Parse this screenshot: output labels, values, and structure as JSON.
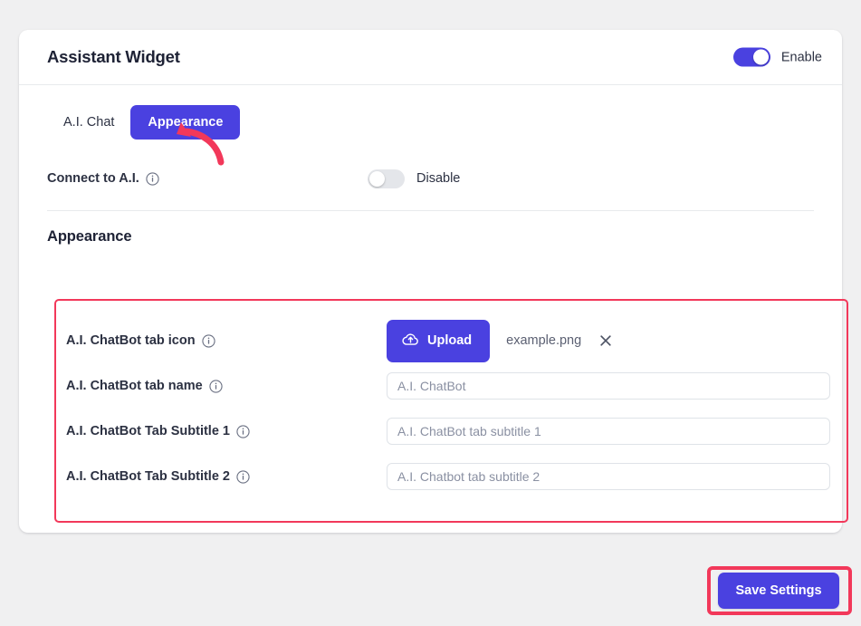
{
  "card": {
    "title": "Assistant Widget",
    "enable_toggle": {
      "label": "Enable",
      "state": "on",
      "icon": "toggle-on-icon"
    }
  },
  "tabs": [
    {
      "label": "A.I. Chat",
      "active": false
    },
    {
      "label": "Appearance",
      "active": true
    }
  ],
  "annotation": {
    "arrow_icon": "curved-arrow-icon",
    "color": "#f2385a"
  },
  "connect": {
    "label": "Connect to A.I.",
    "info_icon": "info-icon",
    "toggle": {
      "label": "Disable",
      "state": "off",
      "icon": "toggle-off-icon"
    }
  },
  "section": {
    "title": "Appearance"
  },
  "form": {
    "rows": [
      {
        "label": "A.I. ChatBot tab icon",
        "info_icon": "info-icon",
        "type": "upload",
        "upload_label": "Upload",
        "upload_icon": "cloud-upload-icon",
        "file_name": "example.png",
        "remove_icon": "close-icon"
      },
      {
        "label": "A.I. ChatBot tab name",
        "info_icon": "info-icon",
        "type": "text",
        "value": "",
        "placeholder": "A.I. ChatBot"
      },
      {
        "label": "A.I. ChatBot Tab Subtitle 1",
        "info_icon": "info-icon",
        "type": "text",
        "value": "",
        "placeholder": "A.I. ChatBot tab subtitle 1"
      },
      {
        "label": "A.I. ChatBot Tab Subtitle 2",
        "info_icon": "info-icon",
        "type": "text",
        "value": "",
        "placeholder": "A.I. Chatbot tab subtitle 2"
      }
    ]
  },
  "footer": {
    "save_label": "Save Settings",
    "highlighted": true
  },
  "colors": {
    "accent": "#4a41e0",
    "highlight": "#f2385a",
    "page_background": "#f0f0f1",
    "card_background": "#ffffff",
    "text_primary": "#2c3142",
    "text_muted": "#8a90a2",
    "toggle_off": "#e4e6ea"
  }
}
